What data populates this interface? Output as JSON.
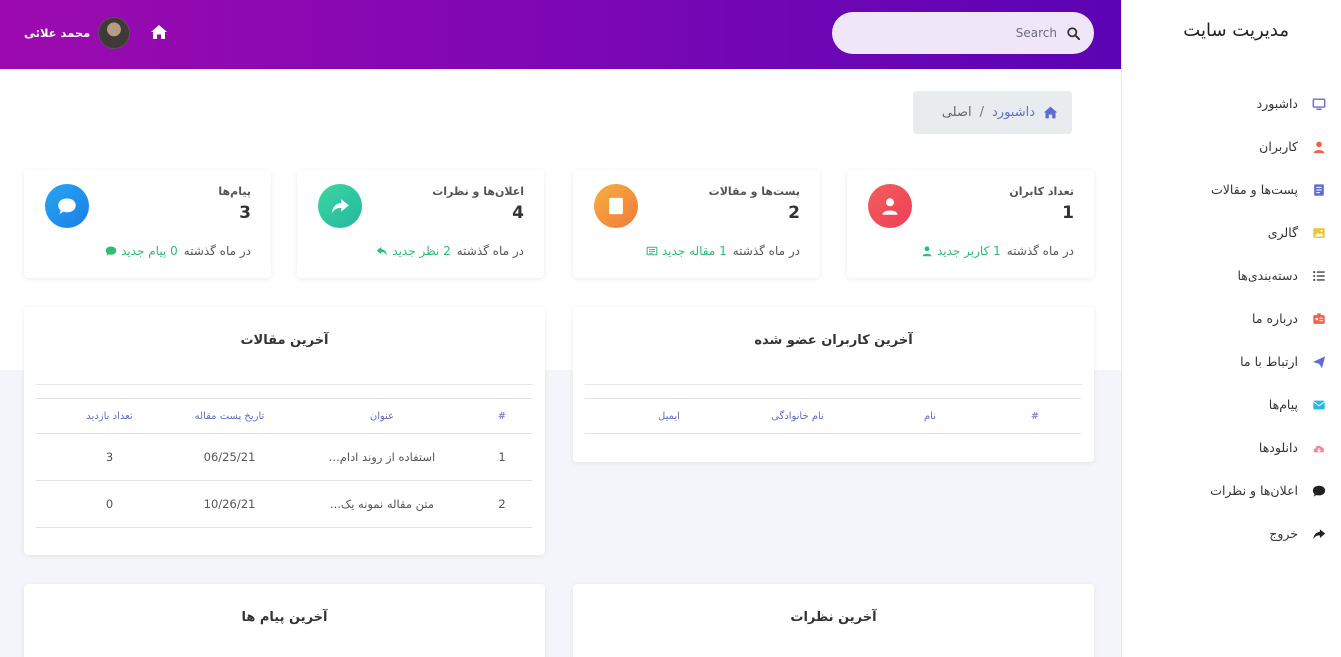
{
  "app": {
    "brand": "مدیریت سایت"
  },
  "sidebar": {
    "items": [
      {
        "label": "داشبورد",
        "icon": "monitor-icon",
        "color": "#5f6cd0"
      },
      {
        "label": "کاربران",
        "icon": "user-icon",
        "color": "#f0624a"
      },
      {
        "label": "پست‌ها و مقالات",
        "icon": "document-icon",
        "color": "#5f6cd0"
      },
      {
        "label": "گالری",
        "icon": "image-icon",
        "color": "#f2c230"
      },
      {
        "label": "دسته‌بندی‌ها",
        "icon": "list-icon",
        "color": "#444444"
      },
      {
        "label": "درباره ما",
        "icon": "id-card-icon",
        "color": "#f0624a"
      },
      {
        "label": "ارتباط با ما",
        "icon": "paper-plane-icon",
        "color": "#5f6cd0"
      },
      {
        "label": "پیام‌ها",
        "icon": "envelope-icon",
        "color": "#23b8e6"
      },
      {
        "label": "دانلودها",
        "icon": "cloud-download-icon",
        "color": "#f08aa0"
      },
      {
        "label": "اعلان‌ها و نظرات",
        "icon": "comment-icon",
        "color": "#222222"
      },
      {
        "label": "خروج",
        "icon": "share-icon",
        "color": "#222222"
      }
    ]
  },
  "header": {
    "search_placeholder": "Search",
    "user_name": "محمد علائی"
  },
  "breadcrumb": {
    "root": "داشبورد",
    "current": "اصلی",
    "separator": "/"
  },
  "stats": [
    {
      "title": "تعداد کابران",
      "value": "1",
      "new_text": "1 کاربر جدید",
      "period": "در ماه گذشته",
      "icon": "user-icon",
      "gradient": [
        "#f0605a",
        "#f23c5a"
      ],
      "foot_icon": "user-small-icon"
    },
    {
      "title": "پست‌ها و مقالات",
      "value": "2",
      "new_text": "1 مقاله جدید",
      "period": "در ماه گذشته",
      "icon": "document-icon",
      "gradient": [
        "#f7b042",
        "#f1793a"
      ],
      "foot_icon": "newspaper-icon"
    },
    {
      "title": "اعلان‌ها و نظرات",
      "value": "4",
      "new_text": "2 نظر جدید",
      "period": "در ماه گذشته",
      "icon": "share-icon",
      "gradient": [
        "#3dd6a0",
        "#22b8a0"
      ],
      "foot_icon": "reply-icon"
    },
    {
      "title": "پیام‌ها",
      "value": "3",
      "new_text": "0 پیام جدید",
      "period": "در ماه گذشته",
      "icon": "comment-icon",
      "gradient": [
        "#27a6f2",
        "#1b7ee8"
      ],
      "foot_icon": "comment-small-icon"
    }
  ],
  "latest_users": {
    "title": "آخرین کاربران عضو شده",
    "columns": [
      "#",
      "نام",
      "نام خانوادگی",
      "ایمیل"
    ]
  },
  "latest_articles": {
    "title": "آخرین مقالات",
    "columns": [
      "#",
      "عنوان",
      "تاریخ پست مقاله",
      "تعداد بازدید"
    ],
    "rows": [
      {
        "num": "1",
        "title": "استفاده از روند ادام...",
        "date": "06/25/21",
        "views": "3"
      },
      {
        "num": "2",
        "title": "متن مقاله نمونه یک...",
        "date": "10/26/21",
        "views": "0"
      }
    ]
  },
  "latest_comments": {
    "title": "آخرین نظرات"
  },
  "latest_messages": {
    "title": "آخرین پیام ها"
  }
}
